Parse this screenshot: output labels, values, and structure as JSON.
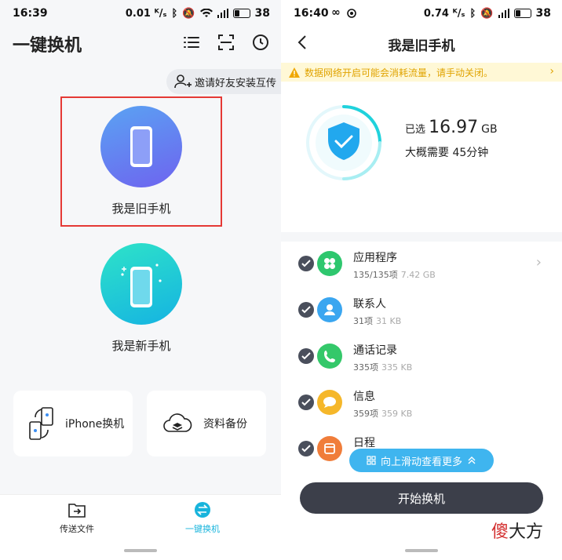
{
  "left": {
    "status": {
      "time": "16:39",
      "speed": "0.01 ᴷ/ₛ",
      "battery": "38"
    },
    "title": "一键换机",
    "header_icons": [
      "list-icon",
      "scan-icon",
      "history-icon"
    ],
    "invite_label": "邀请好友安装互传",
    "old_phone_label": "我是旧手机",
    "new_phone_label": "我是新手机",
    "cards": [
      {
        "label": "iPhone换机",
        "icon": "iphone-transfer-icon"
      },
      {
        "label": "资料备份",
        "icon": "cloud-backup-icon"
      }
    ],
    "bottom_nav": [
      {
        "label": "传送文件",
        "icon": "folder-transfer-icon"
      },
      {
        "label": "一键换机",
        "icon": "swap-icon",
        "active": true
      }
    ],
    "colors": {
      "accent": "#18b4dc",
      "old_phone": "#6e7cf0",
      "new_phone": "#20cbd8",
      "highlight": "#e53935"
    }
  },
  "right": {
    "status": {
      "time": "16:40",
      "speed": "0.74 ᴷ/ₛ",
      "battery": "38"
    },
    "title": "我是旧手机",
    "warning": "数据网络开启可能会消耗流量，请手动关闭。",
    "selected_prefix": "已选",
    "selected_size": "16.97",
    "selected_unit": "GB",
    "duration": "大概需要 45分钟",
    "items": [
      {
        "name": "应用程序",
        "count": "135/135项",
        "size": "7.42 GB",
        "icon": "apps-icon",
        "color": "#2ec76e"
      },
      {
        "name": "联系人",
        "count": "31项",
        "size": "31 KB",
        "icon": "contact-icon",
        "color": "#3aa6f0"
      },
      {
        "name": "通话记录",
        "count": "335项",
        "size": "335 KB",
        "icon": "phone-icon",
        "color": "#34c86a"
      },
      {
        "name": "信息",
        "count": "359项",
        "size": "359 KB",
        "icon": "message-icon",
        "color": "#f5b72a"
      },
      {
        "name": "日程",
        "count": "",
        "size": "",
        "icon": "calendar-icon",
        "color": "#f07d3a"
      }
    ],
    "scroll_hint": "向上滑动查看更多",
    "start_button": "开始换机",
    "watermark_red": "傻",
    "watermark_dark": "大方"
  }
}
